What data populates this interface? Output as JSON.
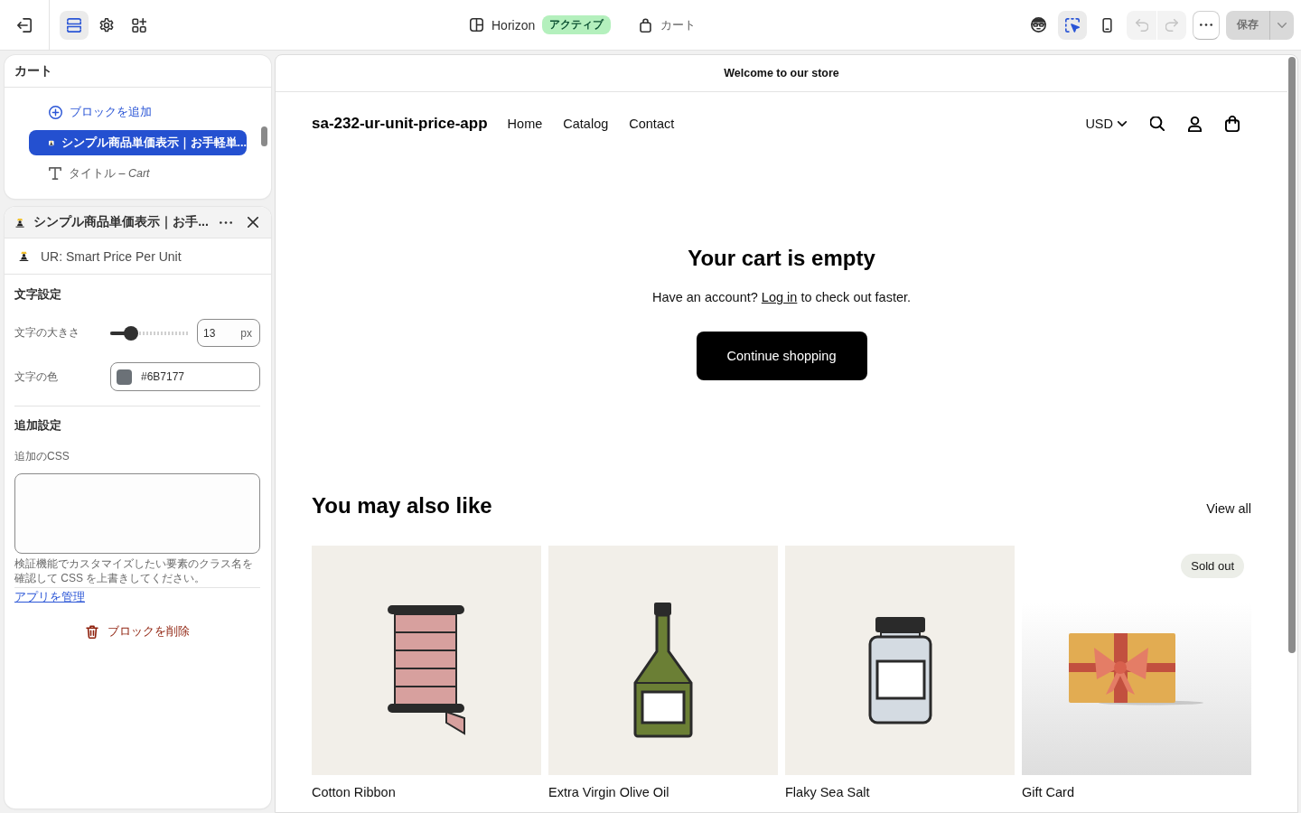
{
  "top_bar": {
    "sidebar_tabs": [
      {
        "kind": "sections",
        "selected": true
      },
      {
        "kind": "settings",
        "selected": false
      },
      {
        "kind": "apps",
        "selected": false
      }
    ],
    "theme": {
      "name": "Horizon",
      "status": "アクティブ"
    },
    "page": "カート",
    "view_tools": [
      {
        "kind": "inspect",
        "selected": false
      },
      {
        "kind": "select",
        "selected": true
      },
      {
        "kind": "mobile",
        "selected": false
      }
    ],
    "undo": {
      "disabled": true
    },
    "redo": {
      "disabled": true
    },
    "save": {
      "label": "保存",
      "disabled": true
    }
  },
  "sections_panel": {
    "title": "カート",
    "items": [
      {
        "kind": "add",
        "label": "ブロックを追加",
        "selected": false
      },
      {
        "kind": "block",
        "label": "シンプル商品単価表示｜お手軽単...",
        "selected": true
      },
      {
        "kind": "text",
        "label": "タイトル *– Cart*",
        "selected": false
      }
    ]
  },
  "block_panel": {
    "title": "シンプル商品単価表示｜お手...",
    "app_name": "UR: Smart Price Per Unit",
    "text_settings": {
      "heading": "文字設定",
      "font_size": {
        "label": "文字の大きさ",
        "level": 0.26,
        "value": "13",
        "unit": "px"
      },
      "font_color": {
        "label": "文字の色",
        "color": "#6b7177",
        "value": "#6B7177"
      }
    },
    "additional_settings": {
      "heading": "追加設定",
      "custom_css": {
        "label": "追加のCSS",
        "help": "検証機能でカスタマイズしたい要素のクラス名を確認して CSS を上書きしてください。"
      }
    },
    "manage_link": "アプリを管理",
    "remove_button": "ブロックを削除"
  },
  "preview": {
    "announcement": "Welcome to our store",
    "header": {
      "logo": "sa-232-ur-unit-price-app",
      "nav": [
        "Home",
        "Catalog",
        "Contact"
      ],
      "currency": "USD"
    },
    "cart": {
      "title": "Your cart is empty",
      "prompt_before": "Have an account?",
      "login_link": "Log in",
      "prompt_after": "to check out faster.",
      "button": "Continue shopping"
    },
    "recommendations": {
      "title": "You may also like",
      "view_all": "View all",
      "products": [
        {
          "kind": "ribbon",
          "title": "Cotton Ribbon"
        },
        {
          "kind": "oil",
          "title": "Extra Virgin Olive Oil"
        },
        {
          "kind": "salt",
          "title": "Flaky Sea Salt"
        },
        {
          "kind": "giftcard",
          "title": "Gift Card",
          "badge": "Sold out"
        }
      ]
    }
  }
}
